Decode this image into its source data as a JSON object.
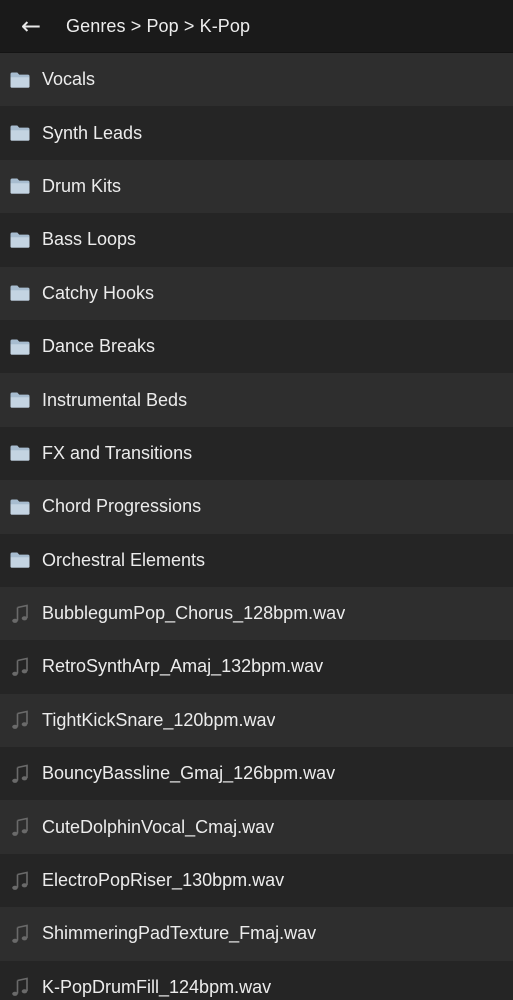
{
  "header": {
    "back_glyph": "←",
    "back_icon": "back-arrow-icon",
    "breadcrumb": "Genres > Pop > K-Pop"
  },
  "colors": {
    "background": "#1e1e1e",
    "row_odd": "#2e2e2e",
    "row_even": "#252525",
    "text": "#ececec",
    "folder_icon": "#a7bccf",
    "audio_icon": "#6a6a6a"
  },
  "items": [
    {
      "type": "folder",
      "icon": "folder-icon",
      "label": "Vocals"
    },
    {
      "type": "folder",
      "icon": "folder-icon",
      "label": "Synth Leads"
    },
    {
      "type": "folder",
      "icon": "folder-icon",
      "label": "Drum Kits"
    },
    {
      "type": "folder",
      "icon": "folder-icon",
      "label": "Bass Loops"
    },
    {
      "type": "folder",
      "icon": "folder-icon",
      "label": "Catchy Hooks"
    },
    {
      "type": "folder",
      "icon": "folder-icon",
      "label": "Dance Breaks"
    },
    {
      "type": "folder",
      "icon": "folder-icon",
      "label": "Instrumental Beds"
    },
    {
      "type": "folder",
      "icon": "folder-icon",
      "label": "FX and Transitions"
    },
    {
      "type": "folder",
      "icon": "folder-icon",
      "label": "Chord Progressions"
    },
    {
      "type": "folder",
      "icon": "folder-icon",
      "label": "Orchestral Elements"
    },
    {
      "type": "audio",
      "icon": "music-note-icon",
      "label": "BubblegumPop_Chorus_128bpm.wav"
    },
    {
      "type": "audio",
      "icon": "music-note-icon",
      "label": "RetroSynthArp_Amaj_132bpm.wav"
    },
    {
      "type": "audio",
      "icon": "music-note-icon",
      "label": "TightKickSnare_120bpm.wav"
    },
    {
      "type": "audio",
      "icon": "music-note-icon",
      "label": "BouncyBassline_Gmaj_126bpm.wav"
    },
    {
      "type": "audio",
      "icon": "music-note-icon",
      "label": "CuteDolphinVocal_Cmaj.wav"
    },
    {
      "type": "audio",
      "icon": "music-note-icon",
      "label": "ElectroPopRiser_130bpm.wav"
    },
    {
      "type": "audio",
      "icon": "music-note-icon",
      "label": "ShimmeringPadTexture_Fmaj.wav"
    },
    {
      "type": "audio",
      "icon": "music-note-icon",
      "label": "K-PopDrumFill_124bpm.wav"
    }
  ]
}
